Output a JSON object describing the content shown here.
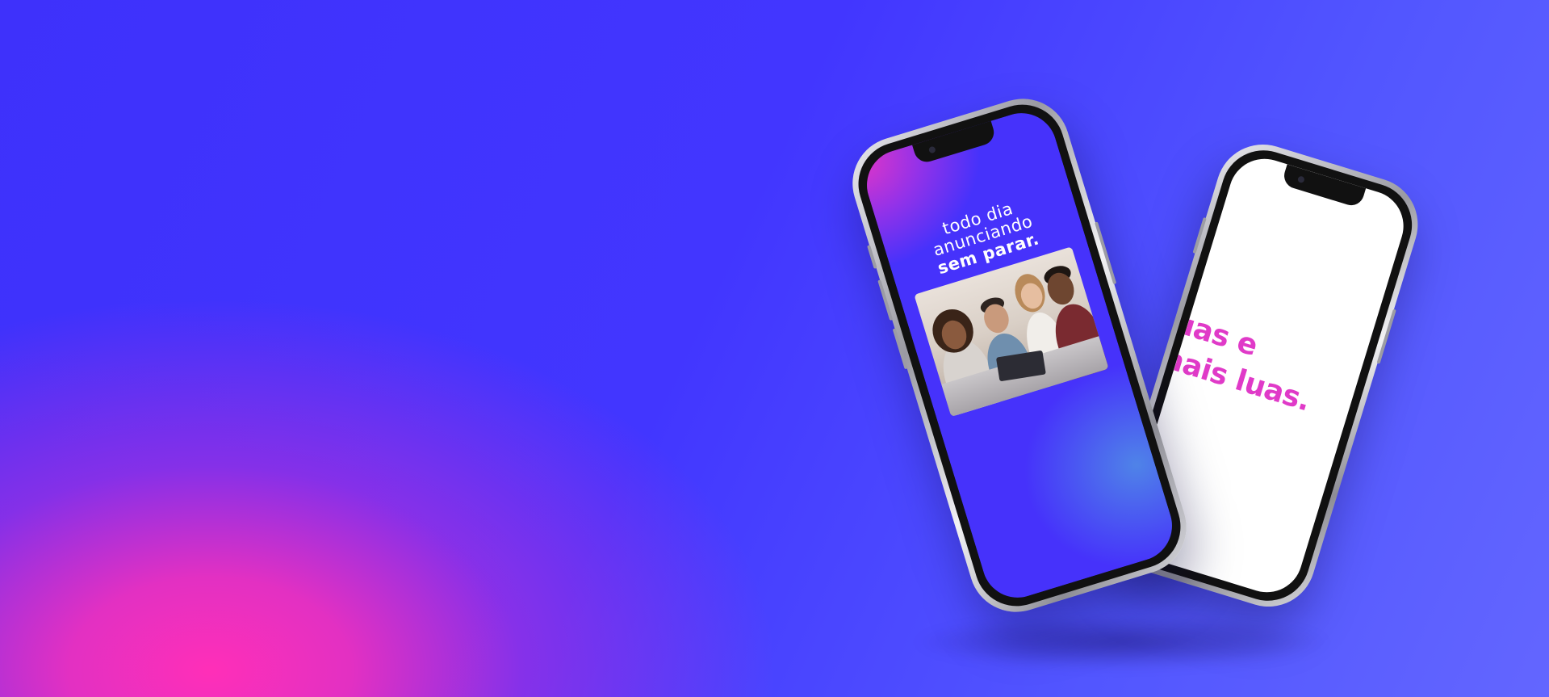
{
  "front_screen": {
    "line1": "todo dia",
    "line2": "anunciando",
    "line3": "sem parar."
  },
  "back_screen": {
    "line1": "luas e",
    "line2": "mais luas."
  },
  "colors": {
    "background_blue": "#4236ff",
    "background_pink": "#ff2fb8",
    "back_text_color": "#e03ac8",
    "front_screen_blue": "#4632fb"
  },
  "icons": {
    "photo": "group-people-photo",
    "camera": "front-camera-icon"
  }
}
